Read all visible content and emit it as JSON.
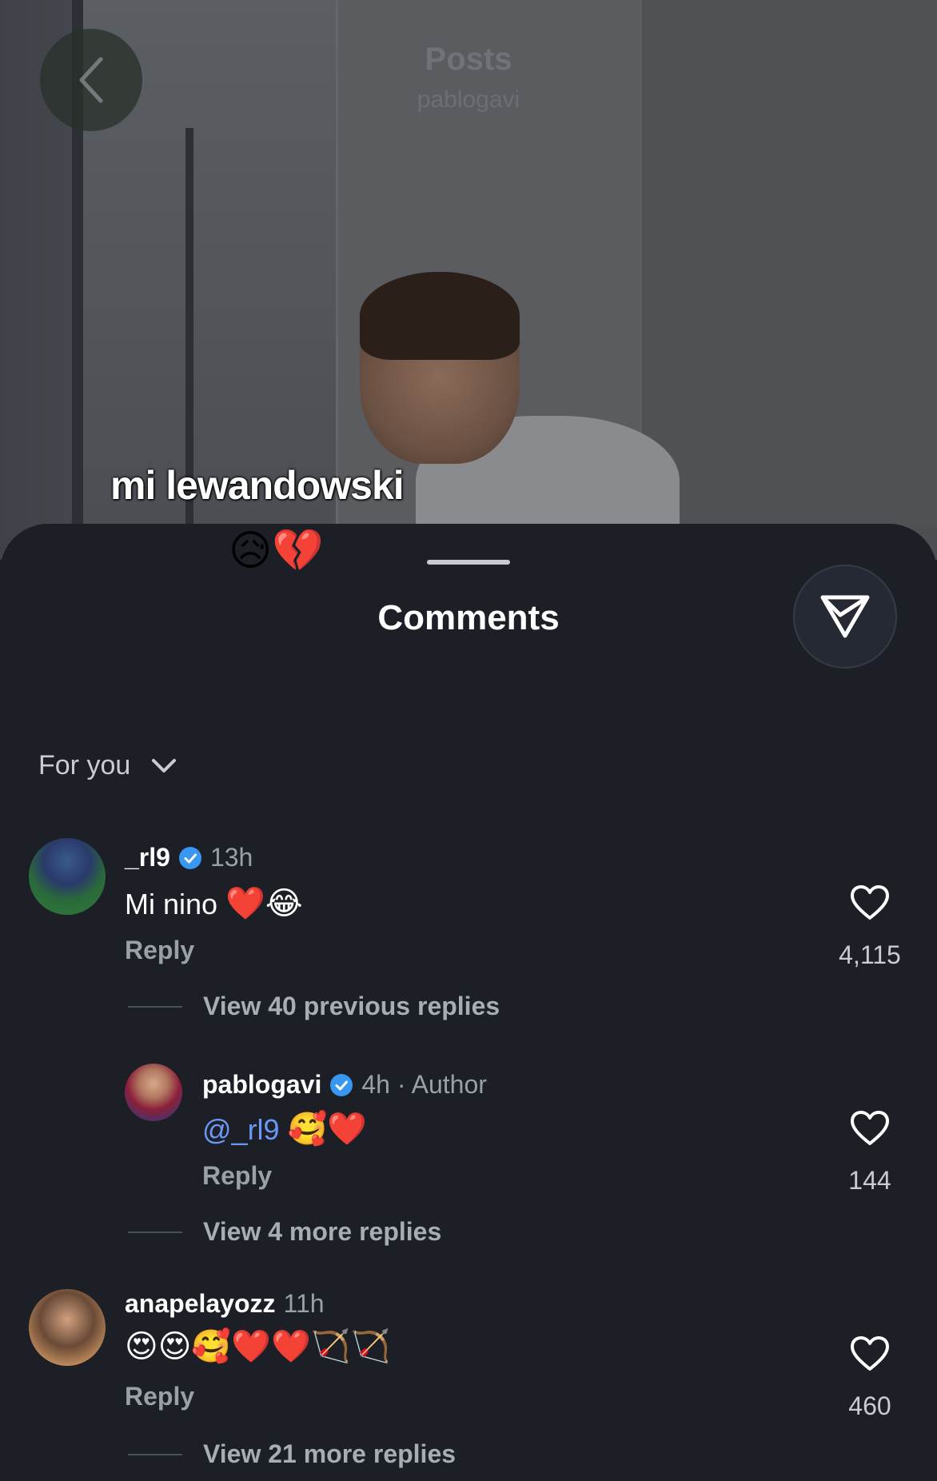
{
  "header": {
    "title": "Posts",
    "subtitle": "pablogavi"
  },
  "post": {
    "caption": "mi lewandowski",
    "caption_emoji": "😥💔"
  },
  "sheet": {
    "title": "Comments"
  },
  "sort": {
    "label": "For you"
  },
  "comments": [
    {
      "user": "_rl9",
      "time": "13h",
      "text": "Mi nino",
      "emoji": "❤️😂",
      "reply": "Reply",
      "likes": "4,115",
      "view_replies": "View 40 previous replies"
    },
    {
      "user": "pablogavi",
      "time": "4h",
      "author": " · Author",
      "mention": "@_rl9",
      "emoji": "🥰❤️",
      "reply": "Reply",
      "likes": "144",
      "view_replies": "View 4 more replies"
    },
    {
      "user": "anapelayozz",
      "time": "11h",
      "emoji": "😍😍🥰❤️❤️🏹🏹",
      "reply": "Reply",
      "likes": "460",
      "view_replies": "View 21 more replies"
    }
  ],
  "colors": {
    "sheet_bg": "#1c1f26",
    "mention": "#6b97f7",
    "verified": "#3897f0"
  },
  "icons": [
    "back-chevron-icon",
    "share-paper-plane-icon",
    "chevron-down-icon",
    "verified-badge-icon",
    "heart-icon"
  ]
}
